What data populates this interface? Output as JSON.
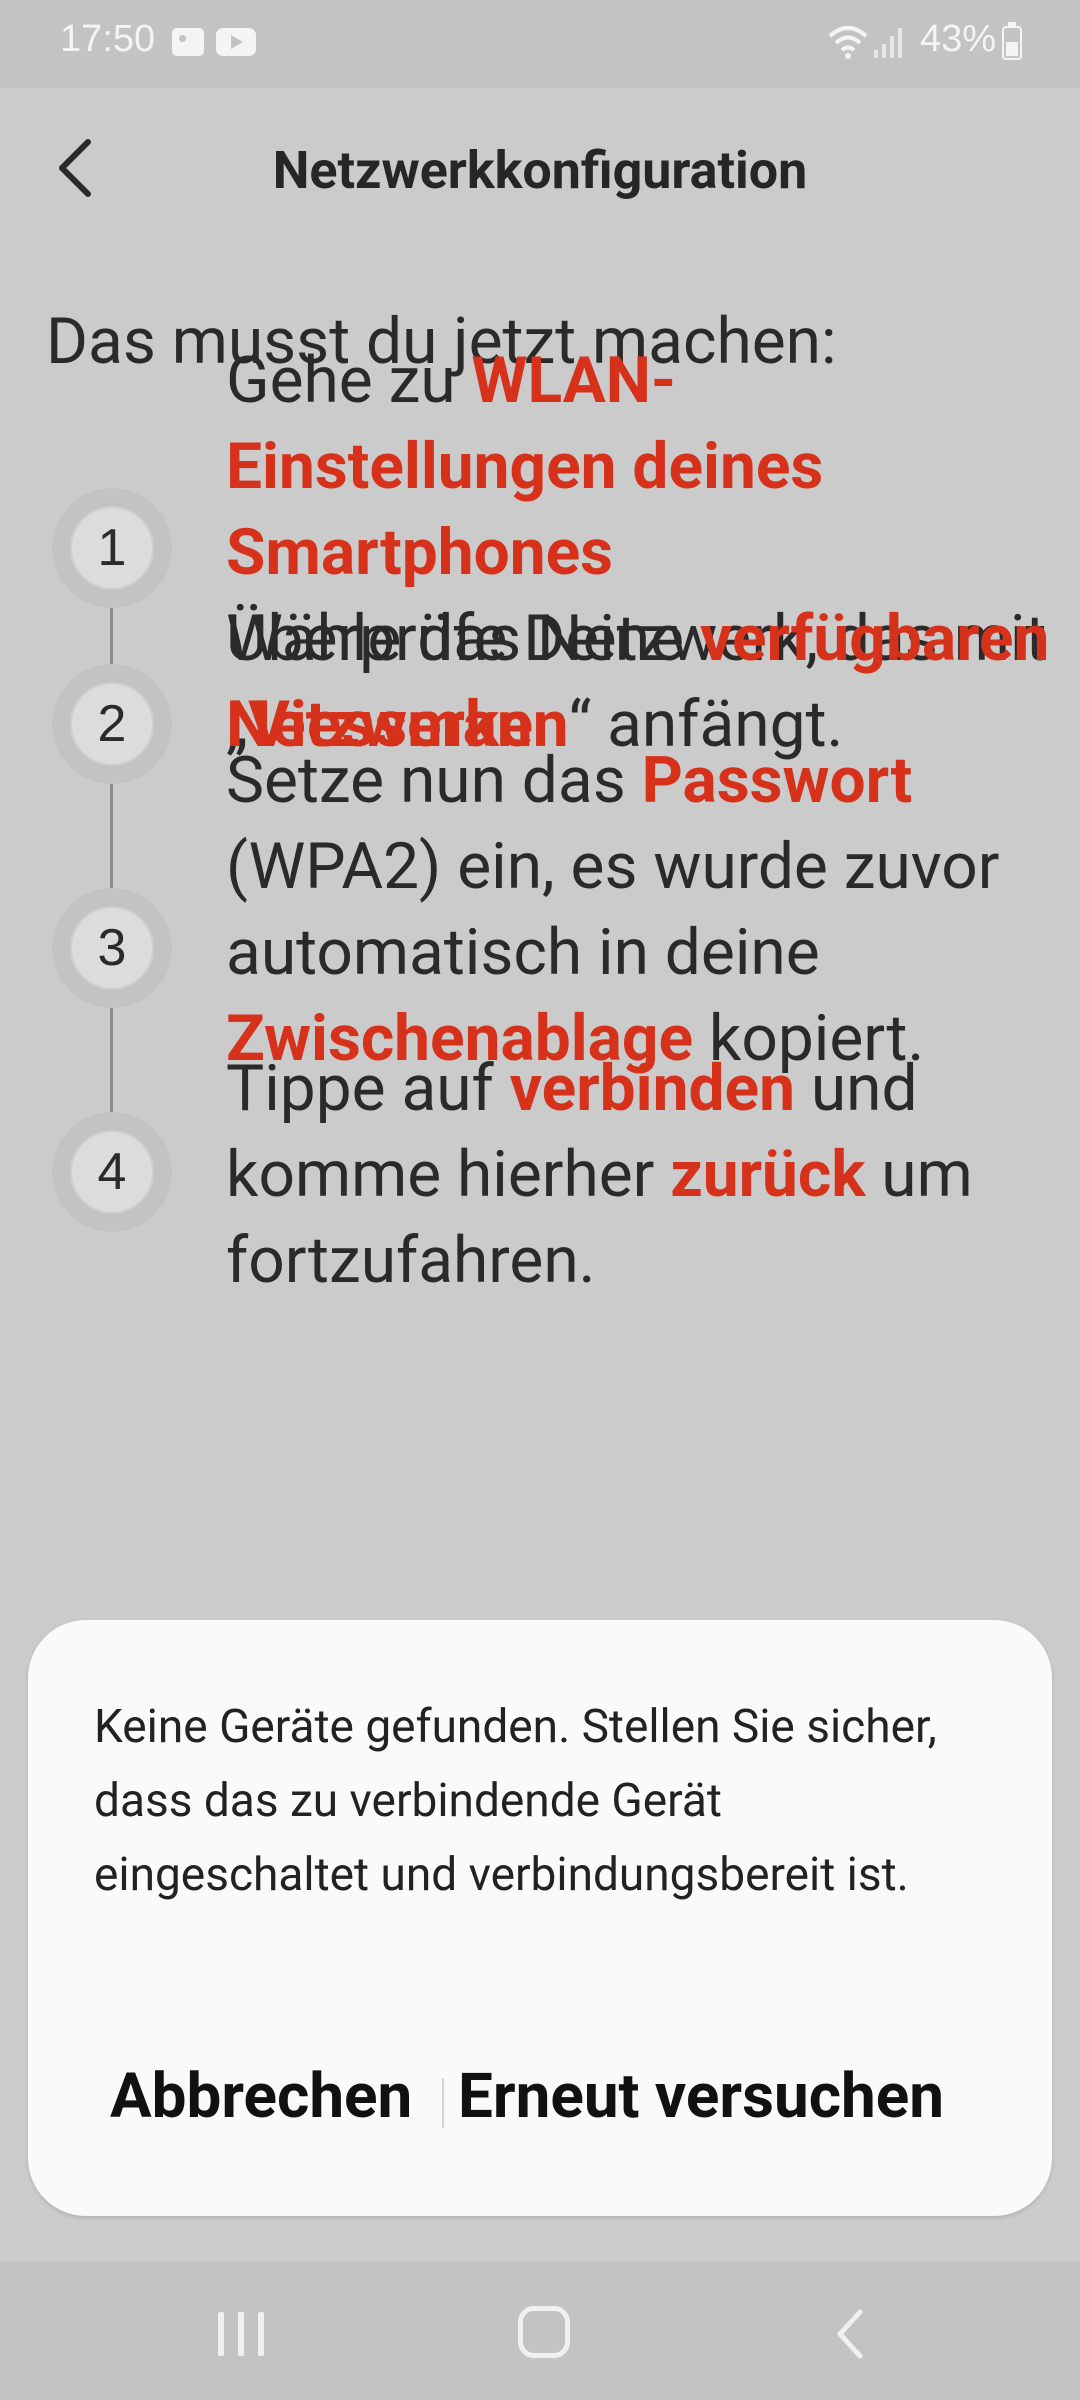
{
  "status_bar": {
    "time": "17:50",
    "battery": "43%"
  },
  "header": {
    "title": "Netzwerkkonfiguration"
  },
  "heading": "Das musst du jetzt machen:",
  "steps": [
    {
      "number": "1",
      "before": "Gehe zu ",
      "highlight": "WLAN-Einstellungen deines Smartphones",
      "after": ""
    },
    {
      "number": "2",
      "before": "Wähle das Netzwerk, das mit „",
      "highlight": "Viessmann",
      "after": "“ anfängt."
    },
    {
      "number": "2",
      "before": "Überprüfe Deine ",
      "highlight": "verfügbaren Netzwerke",
      "after": ""
    },
    {
      "number": "3",
      "before": "Setze nun das ",
      "highlight": "Passwort",
      "middle": " (WPA2) ein, es wurde zuvor automatisch in deine ",
      "highlight2": "Zwischenablage",
      "after": " kopiert."
    },
    {
      "number": "4",
      "before": "Tippe auf ",
      "highlight": "verbinden",
      "middle": " und komme hierher ",
      "highlight2": "zurück",
      "after": " um fortzufahren."
    }
  ],
  "dialog": {
    "message": "Keine Geräte gefunden. Stellen Sie sicher, dass das zu verbindende Gerät eingeschaltet und verbindungsbereit ist.",
    "cancel_label": "Abbrechen",
    "retry_label": "Erneut versuchen"
  },
  "colors": {
    "accent": "#d6311a",
    "scrim": "#cbcbcb",
    "dialog_bg": "#fafafa"
  }
}
